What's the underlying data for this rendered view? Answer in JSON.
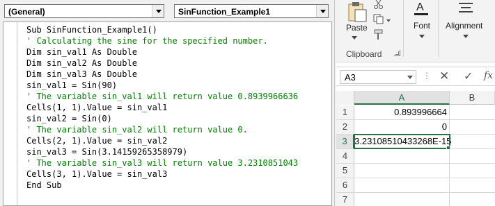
{
  "vba_editor": {
    "object_combo": "(General)",
    "procedure_combo": "SinFunction_Example1",
    "code_lines": [
      {
        "text": "Sub SinFunction_Example1()",
        "kind": "code"
      },
      {
        "text": "' Calculating the sine for the specified number.",
        "kind": "comment"
      },
      {
        "text": "Dim sin_val1 As Double",
        "kind": "code"
      },
      {
        "text": "Dim sin_val2 As Double",
        "kind": "code"
      },
      {
        "text": "Dim sin_val3 As Double",
        "kind": "code"
      },
      {
        "text": "sin_val1 = Sin(90)",
        "kind": "code"
      },
      {
        "text": "' The variable sin_val1 will return value 0.8939966636",
        "kind": "comment"
      },
      {
        "text": "Cells(1, 1).Value = sin_val1",
        "kind": "code"
      },
      {
        "text": "sin_val2 = Sin(0)",
        "kind": "code"
      },
      {
        "text": "' The variable sin_val2 will return value 0.",
        "kind": "comment"
      },
      {
        "text": "Cells(2, 1).Value = sin_val2",
        "kind": "code"
      },
      {
        "text": "sin_val3 = Sin(3.14159265358979)",
        "kind": "code"
      },
      {
        "text": "' The variable sin_val3 will return value 3.2310851043",
        "kind": "comment"
      },
      {
        "text": "Cells(3, 1).Value = sin_val3",
        "kind": "code"
      },
      {
        "text": "End Sub",
        "kind": "code"
      }
    ]
  },
  "excel": {
    "ribbon": {
      "paste_label": "Paste",
      "font_label": "Font",
      "alignment_label": "Alignment",
      "clipboard_group_label": "Clipboard"
    },
    "formula_bar": {
      "name_box": "A3",
      "cancel_icon": "✕",
      "enter_icon": "✓",
      "fx_label": "fx"
    },
    "columns": [
      "A",
      "B"
    ],
    "rows": [
      {
        "num": "1",
        "a": "0.893996664",
        "b": ""
      },
      {
        "num": "2",
        "a": "0",
        "b": ""
      },
      {
        "num": "3",
        "a": "3.23108510433268E-15",
        "b": ""
      },
      {
        "num": "4",
        "a": "",
        "b": ""
      },
      {
        "num": "5",
        "a": "",
        "b": ""
      },
      {
        "num": "6",
        "a": "",
        "b": ""
      },
      {
        "num": "7",
        "a": "",
        "b": ""
      }
    ],
    "selected_cell": "A3",
    "accent_color": "#217346"
  }
}
